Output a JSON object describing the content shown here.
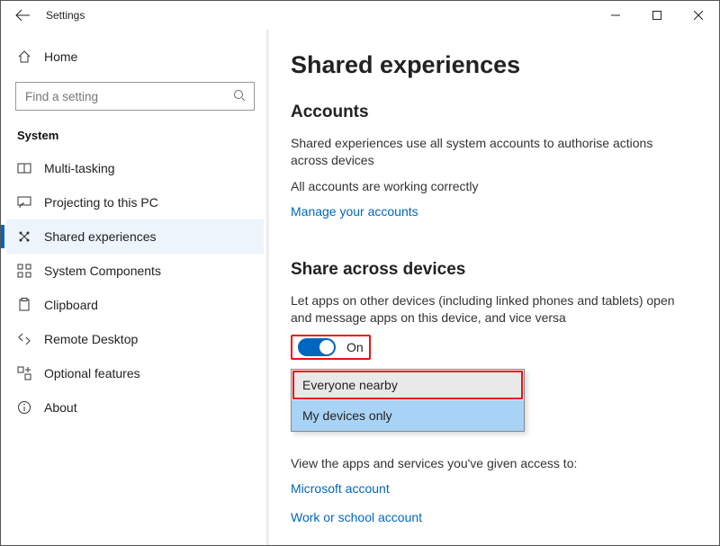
{
  "app_title": "Settings",
  "home_label": "Home",
  "search": {
    "placeholder": "Find a setting"
  },
  "category_title": "System",
  "sidebar": {
    "items": [
      {
        "label": "Multi-tasking"
      },
      {
        "label": "Projecting to this PC"
      },
      {
        "label": "Shared experiences"
      },
      {
        "label": "System Components"
      },
      {
        "label": "Clipboard"
      },
      {
        "label": "Remote Desktop"
      },
      {
        "label": "Optional features"
      },
      {
        "label": "About"
      }
    ]
  },
  "page": {
    "title": "Shared experiences",
    "accounts": {
      "heading": "Accounts",
      "desc": "Shared experiences use all system accounts to authorise actions across devices",
      "status": "All accounts are working correctly",
      "manage_link": "Manage your accounts"
    },
    "share": {
      "heading": "Share across devices",
      "desc": "Let apps on other devices (including linked phones and tablets) open and message apps on this device, and vice versa",
      "toggle_label": "On",
      "options": [
        "Everyone nearby",
        "My devices only"
      ],
      "access_text": "View the apps and services you've given access to:",
      "links": [
        "Microsoft account",
        "Work or school account"
      ]
    }
  }
}
